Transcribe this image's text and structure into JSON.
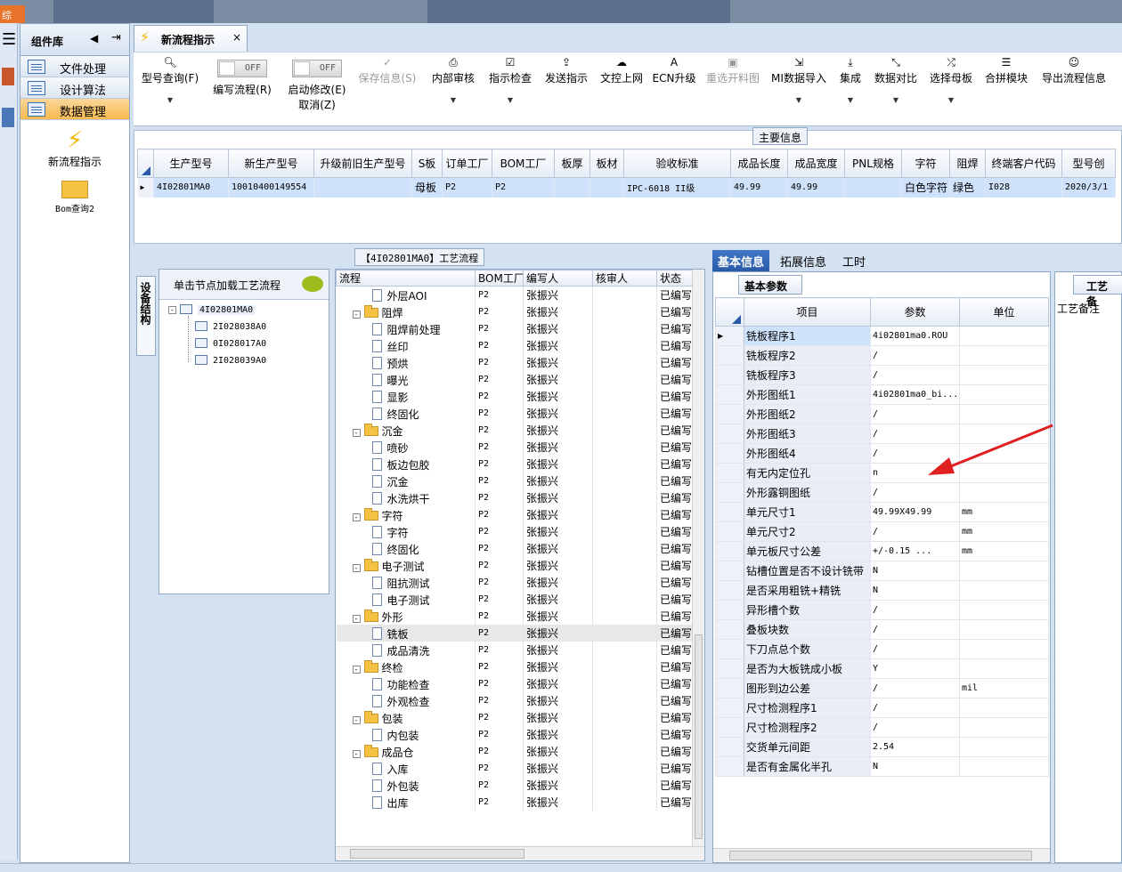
{
  "component_panel": {
    "title": "组件库",
    "nav_items": [
      {
        "label": "文件处理"
      },
      {
        "label": "设计算法"
      },
      {
        "label": "数据管理"
      }
    ],
    "shortcuts": [
      {
        "label": "新流程指示",
        "icon": "lightning-icon"
      },
      {
        "label": "Bom查询2",
        "icon": "folder-open-icon"
      }
    ]
  },
  "tab": {
    "title": "新流程指示",
    "close": "×"
  },
  "toolbar": {
    "model_query": "型号查询(F)",
    "edit_flow_toggle": "OFF",
    "edit_flow": "编写流程(R)",
    "start_modify_toggle": "OFF",
    "start_modify": "启动修改(E)",
    "cancel": "取消(Z)",
    "save_info": "保存信息(S)",
    "internal_review": "内部审核",
    "directive_check": "指示检查",
    "send_directive": "发送指示",
    "doc_upload": "文控上网",
    "ecn_upgrade": "ECN升级",
    "reselect_image": "重选开料图",
    "mi_import": "MI数据导入",
    "integrate": "集成",
    "data_compare": "数据对比",
    "select_mother": "选择母板",
    "merge_module": "合拼模块",
    "export_flow": "导出流程信息"
  },
  "main_info": {
    "title": "主要信息",
    "columns": [
      "生产型号",
      "新生产型号",
      "升级前旧生产型号",
      "S板",
      "订单工厂",
      "BOM工厂",
      "板厚",
      "板材",
      "验收标准",
      "成品长度",
      "成品宽度",
      "PNL规格",
      "字符",
      "阻焊",
      "终端客户代码",
      "型号创"
    ],
    "row": [
      "4I02801MA0",
      "10010400149554",
      "",
      "母板",
      "P2",
      "P2",
      "",
      "",
      "IPC-6018 II级",
      "49.99",
      "49.99",
      "",
      "白色字符",
      "绿色",
      "I028",
      "2020/3/1"
    ]
  },
  "structure": {
    "vtab": "设备结构",
    "header": "单击节点加载工艺流程",
    "root": "4I02801MA0",
    "children": [
      "2I028038A0",
      "0I028017A0",
      "2I028039A0"
    ]
  },
  "process": {
    "title": "【4I02801MA0】工艺流程",
    "columns": [
      "流程",
      "BOM工厂",
      "编写人",
      "核审人",
      "状态"
    ],
    "rows": [
      {
        "name": "外层AOI",
        "type": "step",
        "factory": "P2",
        "writer": "张振兴",
        "reviewer": "",
        "status": "已编写"
      },
      {
        "name": "阻焊",
        "type": "group",
        "factory": "P2",
        "writer": "张振兴",
        "reviewer": "",
        "status": "已编写"
      },
      {
        "name": "阻焊前处理",
        "type": "step",
        "factory": "P2",
        "writer": "张振兴",
        "reviewer": "",
        "status": "已编写"
      },
      {
        "name": "丝印",
        "type": "step",
        "factory": "P2",
        "writer": "张振兴",
        "reviewer": "",
        "status": "已编写"
      },
      {
        "name": "预烘",
        "type": "step",
        "factory": "P2",
        "writer": "张振兴",
        "reviewer": "",
        "status": "已编写"
      },
      {
        "name": "曝光",
        "type": "step",
        "factory": "P2",
        "writer": "张振兴",
        "reviewer": "",
        "status": "已编写"
      },
      {
        "name": "显影",
        "type": "step",
        "factory": "P2",
        "writer": "张振兴",
        "reviewer": "",
        "status": "已编写"
      },
      {
        "name": "终固化",
        "type": "step",
        "factory": "P2",
        "writer": "张振兴",
        "reviewer": "",
        "status": "已编写"
      },
      {
        "name": "沉金",
        "type": "group",
        "factory": "P2",
        "writer": "张振兴",
        "reviewer": "",
        "status": "已编写"
      },
      {
        "name": "喷砂",
        "type": "step",
        "factory": "P2",
        "writer": "张振兴",
        "reviewer": "",
        "status": "已编写"
      },
      {
        "name": "板边包胶",
        "type": "step",
        "factory": "P2",
        "writer": "张振兴",
        "reviewer": "",
        "status": "已编写"
      },
      {
        "name": "沉金",
        "type": "step",
        "factory": "P2",
        "writer": "张振兴",
        "reviewer": "",
        "status": "已编写"
      },
      {
        "name": "水洗烘干",
        "type": "step",
        "factory": "P2",
        "writer": "张振兴",
        "reviewer": "",
        "status": "已编写"
      },
      {
        "name": "字符",
        "type": "group",
        "factory": "P2",
        "writer": "张振兴",
        "reviewer": "",
        "status": "已编写"
      },
      {
        "name": "字符",
        "type": "step",
        "factory": "P2",
        "writer": "张振兴",
        "reviewer": "",
        "status": "已编写"
      },
      {
        "name": "终固化",
        "type": "step",
        "factory": "P2",
        "writer": "张振兴",
        "reviewer": "",
        "status": "已编写"
      },
      {
        "name": "电子测试",
        "type": "group",
        "factory": "P2",
        "writer": "张振兴",
        "reviewer": "",
        "status": "已编写"
      },
      {
        "name": "阻抗测试",
        "type": "step",
        "factory": "P2",
        "writer": "张振兴",
        "reviewer": "",
        "status": "已编写"
      },
      {
        "name": "电子测试",
        "type": "step",
        "factory": "P2",
        "writer": "张振兴",
        "reviewer": "",
        "status": "已编写"
      },
      {
        "name": "外形",
        "type": "group",
        "factory": "P2",
        "writer": "张振兴",
        "reviewer": "",
        "status": "已编写"
      },
      {
        "name": "铣板",
        "type": "step",
        "factory": "P2",
        "writer": "张振兴",
        "reviewer": "",
        "status": "已编写",
        "selected": true
      },
      {
        "name": "成品清洗",
        "type": "step",
        "factory": "P2",
        "writer": "张振兴",
        "reviewer": "",
        "status": "已编写"
      },
      {
        "name": "终检",
        "type": "group",
        "factory": "P2",
        "writer": "张振兴",
        "reviewer": "",
        "status": "已编写"
      },
      {
        "name": "功能检查",
        "type": "step",
        "factory": "P2",
        "writer": "张振兴",
        "reviewer": "",
        "status": "已编写"
      },
      {
        "name": "外观检查",
        "type": "step",
        "factory": "P2",
        "writer": "张振兴",
        "reviewer": "",
        "status": "已编写"
      },
      {
        "name": "包装",
        "type": "group",
        "factory": "P2",
        "writer": "张振兴",
        "reviewer": "",
        "status": "已编写"
      },
      {
        "name": "内包装",
        "type": "step",
        "factory": "P2",
        "writer": "张振兴",
        "reviewer": "",
        "status": "已编写"
      },
      {
        "name": "成品仓",
        "type": "group",
        "factory": "P2",
        "writer": "张振兴",
        "reviewer": "",
        "status": "已编写"
      },
      {
        "name": "入库",
        "type": "step",
        "factory": "P2",
        "writer": "张振兴",
        "reviewer": "",
        "status": "已编写"
      },
      {
        "name": "外包装",
        "type": "step",
        "factory": "P2",
        "writer": "张振兴",
        "reviewer": "",
        "status": "已编写"
      },
      {
        "name": "出库",
        "type": "step",
        "factory": "P2",
        "writer": "张振兴",
        "reviewer": "",
        "status": "已编写"
      }
    ]
  },
  "right_tabs": [
    "基本信息",
    "拓展信息",
    "工时"
  ],
  "basic": {
    "subtab": "基本参数",
    "columns": [
      "项目",
      "参数",
      "单位"
    ],
    "rows": [
      {
        "item": "铣板程序1",
        "value": "4i02801ma0.ROU",
        "unit": ""
      },
      {
        "item": "铣板程序2",
        "value": "/",
        "unit": ""
      },
      {
        "item": "铣板程序3",
        "value": "/",
        "unit": ""
      },
      {
        "item": "外形图纸1",
        "value": "4i02801ma0_bi...",
        "unit": ""
      },
      {
        "item": "外形图纸2",
        "value": "/",
        "unit": ""
      },
      {
        "item": "外形图纸3",
        "value": "/",
        "unit": ""
      },
      {
        "item": "外形图纸4",
        "value": "/",
        "unit": ""
      },
      {
        "item": "有无内定位孔",
        "value": "n",
        "unit": ""
      },
      {
        "item": "外形露铜图纸",
        "value": "/",
        "unit": ""
      },
      {
        "item": "单元尺寸1",
        "value": "49.99X49.99",
        "unit": "mm"
      },
      {
        "item": "单元尺寸2",
        "value": "/",
        "unit": "mm"
      },
      {
        "item": "单元板尺寸公差",
        "value": "+/-0.15      ...",
        "unit": "mm"
      },
      {
        "item": "钻槽位置是否不设计铣带",
        "value": "N",
        "unit": ""
      },
      {
        "item": "是否采用粗铣+精铣",
        "value": "N",
        "unit": ""
      },
      {
        "item": "异形槽个数",
        "value": "/",
        "unit": ""
      },
      {
        "item": "叠板块数",
        "value": "/",
        "unit": ""
      },
      {
        "item": "下刀点总个数",
        "value": "/",
        "unit": ""
      },
      {
        "item": "是否为大板铣成小板",
        "value": "Y",
        "unit": ""
      },
      {
        "item": "图形到边公差",
        "value": "/",
        "unit": "mil"
      },
      {
        "item": "尺寸检测程序1",
        "value": "/",
        "unit": ""
      },
      {
        "item": "尺寸检测程序2",
        "value": "/",
        "unit": ""
      },
      {
        "item": "交货单元间距",
        "value": "2.54",
        "unit": ""
      },
      {
        "item": "是否有金属化半孔",
        "value": "N",
        "unit": ""
      }
    ]
  },
  "remark": {
    "tab": "工艺备",
    "label": "工艺备注"
  },
  "colors": {
    "accent": "#2a5aa8",
    "selection": "#cfe2fb",
    "annotation_arrow": "#e02020",
    "nav_selected": "#f6b94d"
  }
}
